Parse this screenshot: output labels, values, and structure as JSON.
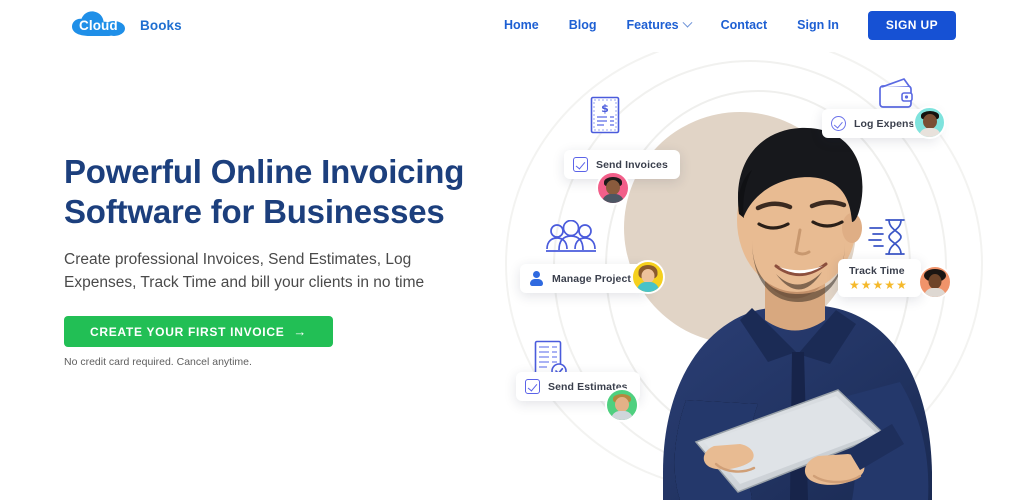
{
  "brand": {
    "cloud_text": "Cloud",
    "books_text": "Books",
    "logo_icon": "cloud-icon",
    "cloud_color": "#1f8fe8",
    "books_color": "#1f6fd0"
  },
  "nav": {
    "items": [
      {
        "label": "Home",
        "icon": null
      },
      {
        "label": "Blog",
        "icon": null
      },
      {
        "label": "Features",
        "icon": "chevron-down-icon"
      },
      {
        "label": "Contact",
        "icon": null
      },
      {
        "label": "Sign In",
        "icon": null
      }
    ],
    "signup_label": "SIGN UP",
    "link_color": "#1d5fd3",
    "signup_bg": "#1651d4"
  },
  "hero": {
    "headline_line1": "Powerful Online Invoicing",
    "headline_line2": "Software for Businesses",
    "headline_color": "#1c3f7d",
    "subheadline": "Create professional Invoices, Send Estimates, Log Expenses, Track Time and bill your clients in no time",
    "cta_label": "CREATE YOUR FIRST INVOICE",
    "cta_arrow": "→",
    "cta_bg": "#22bf55",
    "fineprint": "No credit card required. Cancel anytime."
  },
  "hero_art": {
    "backdrop_circle_color": "#e1d4c6",
    "ring_color": "#ededeb",
    "cards": [
      {
        "id": "send-invoices",
        "label": "Send Invoices",
        "icon": "checkbox-checked-icon",
        "avatar_color": "#f25f8a",
        "float_icon": "invoice-document-icon"
      },
      {
        "id": "log-expenses",
        "label": "Log Expenses",
        "icon": "circle-check-icon",
        "avatar_color": "#7fe3dd",
        "float_icon": "wallet-icon"
      },
      {
        "id": "manage-projects",
        "label": "Manage Projects",
        "icon": "person-icon",
        "avatar_color": "#f5d01e",
        "float_icon": "team-group-icon"
      },
      {
        "id": "track-time",
        "label": "Track Time",
        "icon": "stars-icon",
        "stars": 5,
        "star_char": "★",
        "star_color": "#f5b92b",
        "avatar_color": "#f0936a",
        "float_icon": "hourglass-icon"
      },
      {
        "id": "send-estimates",
        "label": "Send Estimates",
        "icon": "checkbox-checked-icon",
        "avatar_color": "#4fd07f",
        "float_icon": "estimate-document-check-icon"
      }
    ]
  }
}
